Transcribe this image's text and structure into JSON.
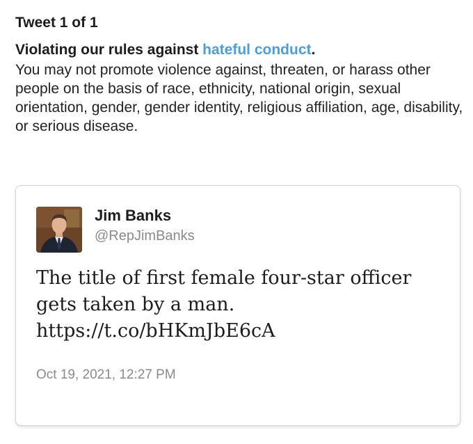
{
  "notice": {
    "tweet_count": "Tweet 1 of 1",
    "violation_prefix": "Violating our rules against ",
    "violation_link": "hateful conduct",
    "violation_suffix": ".",
    "description": "You may not promote violence against, threaten, or harass other people on the basis of race, ethnicity, national origin, sexual orientation, gender, gender identity, religious affiliation, age, disability, or serious disease.",
    "link_color": "#4a9fd8"
  },
  "tweet": {
    "author_name": "Jim Banks",
    "author_handle": "@RepJimBanks",
    "text_line_1": "The title of first female four-star officer",
    "text_line_2": "gets taken by a man.",
    "link": "https://t.co/bHKmJbE6cA",
    "timestamp": "Oct 19, 2021, 12:27 PM",
    "avatar_icon": "user-photo"
  }
}
